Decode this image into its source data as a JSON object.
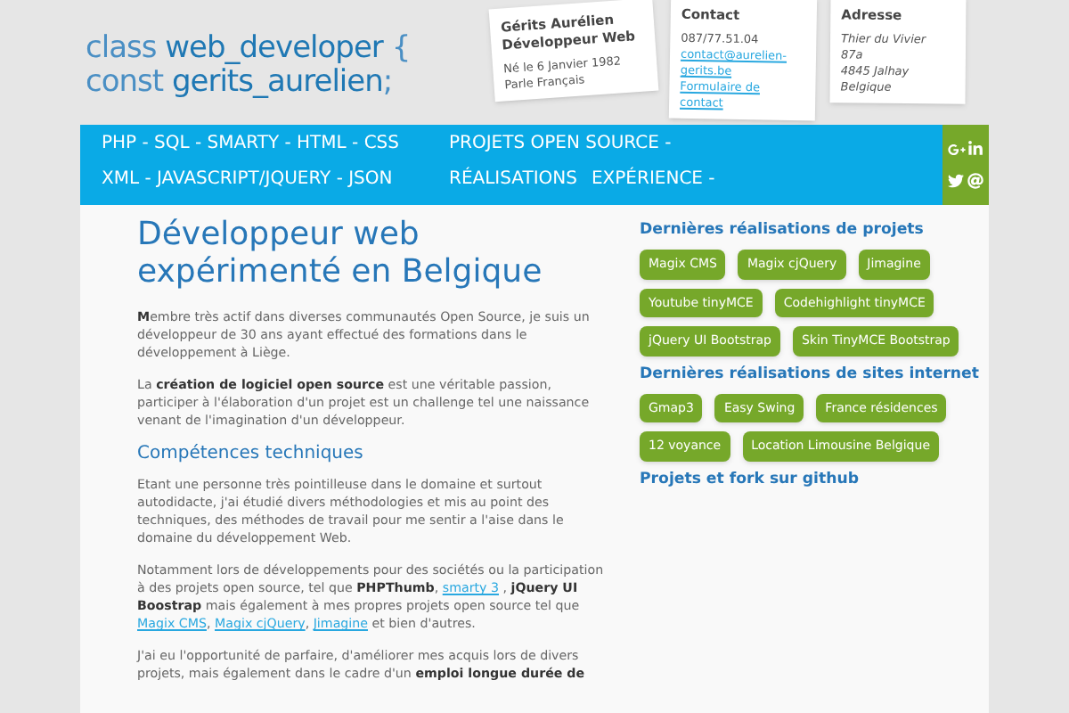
{
  "header": {
    "code_lines": [
      {
        "keyword": "class",
        "name": "web_developer",
        "suffix": "{"
      },
      {
        "keyword": "const",
        "name": "gerits_aurelien",
        "suffix": ";"
      }
    ],
    "cards": [
      {
        "title": [
          "Gérits Aurélien",
          "Développeur Web"
        ],
        "lines": [
          {
            "kind": "text",
            "text": "Né le 6 Janvier 1982"
          },
          {
            "kind": "text",
            "text": "Parle Français"
          }
        ]
      },
      {
        "title": [
          "Contact"
        ],
        "lines": [
          {
            "kind": "text",
            "text": "087/77.51.04"
          },
          {
            "kind": "link",
            "text": "contact@aurelien-gerits.be"
          },
          {
            "kind": "link",
            "text": "Formulaire de contact"
          }
        ]
      },
      {
        "title": [
          "Adresse"
        ],
        "lines": [
          {
            "kind": "italic",
            "text": "Thier du Vivier"
          },
          {
            "kind": "italic",
            "text": "87a"
          },
          {
            "kind": "italic",
            "text": "4845 Jalhay"
          },
          {
            "kind": "italic",
            "text": "Belgique"
          }
        ]
      }
    ]
  },
  "nav": {
    "skills": [
      "PHP - SQL - SMARTY - HTML - CSS",
      "XML - JAVASCRIPT/JQUERY - JSON"
    ],
    "menu": [
      [
        "PROJETS OPEN SOURCE -"
      ],
      [
        "RÉALISATIONS",
        "EXPÉRIENCE -"
      ]
    ]
  },
  "main": {
    "title": "Développeur web expérimenté en Belgique",
    "blocks": [
      {
        "kind": "paragraph",
        "segments": [
          {
            "kind": "bold",
            "text": "M"
          },
          {
            "kind": "text",
            "text": "embre très actif dans diverses communautés Open Source, je suis un développeur de 30 ans ayant effectué des formations dans le développement à Liège."
          }
        ]
      },
      {
        "kind": "paragraph",
        "segments": [
          {
            "kind": "text",
            "text": "La "
          },
          {
            "kind": "bold",
            "text": "création de logiciel open source"
          },
          {
            "kind": "text",
            "text": " est une véritable passion, participer à l'élaboration d'un projet est un challenge tel une naissance venant de l'imagination d'un développeur."
          }
        ]
      },
      {
        "kind": "heading",
        "text": "Compétences techniques"
      },
      {
        "kind": "paragraph",
        "segments": [
          {
            "kind": "text",
            "text": "Etant une personne très pointilleuse dans le domaine et surtout autodidacte, j'ai étudié divers méthodologies et mis au point des techniques, des méthodes de travail pour me sentir a l'aise dans le domaine du développement Web."
          }
        ]
      },
      {
        "kind": "paragraph",
        "segments": [
          {
            "kind": "text",
            "text": "Notamment lors de développements pour des sociétés ou la participation à des projets open source, tel que "
          },
          {
            "kind": "bold",
            "text": "PHPThumb"
          },
          {
            "kind": "text",
            "text": ", "
          },
          {
            "kind": "link",
            "text": "smarty 3"
          },
          {
            "kind": "text",
            "text": " , "
          },
          {
            "kind": "bold",
            "text": "jQuery UI Boostrap"
          },
          {
            "kind": "text",
            "text": " mais également à mes propres projets open source tel que "
          },
          {
            "kind": "link",
            "text": "Magix CMS"
          },
          {
            "kind": "text",
            "text": ", "
          },
          {
            "kind": "link",
            "text": "Magix cjQuery"
          },
          {
            "kind": "text",
            "text": ", "
          },
          {
            "kind": "link",
            "text": "Jimagine"
          },
          {
            "kind": "text",
            "text": " et bien d'autres."
          }
        ]
      },
      {
        "kind": "paragraph",
        "segments": [
          {
            "kind": "text",
            "text": "J'ai eu l'opportunité de parfaire, d'améliorer mes acquis lors de divers projets, mais également dans le cadre d'un "
          },
          {
            "kind": "bold",
            "text": "emploi longue durée de"
          }
        ]
      }
    ]
  },
  "sidebar": [
    {
      "title": "Dernières réalisations de projets",
      "tags": [
        "Magix CMS",
        "Magix cjQuery",
        "Jimagine",
        "Youtube tinyMCE",
        "Codehighlight tinyMCE",
        "jQuery UI Bootstrap",
        "Skin TinyMCE Bootstrap"
      ]
    },
    {
      "title": "Dernières réalisations de sites internet",
      "tags": [
        "Gmap3",
        "Easy Swing",
        "France résidences",
        "12 voyance",
        "Location Limousine Belgique"
      ]
    },
    {
      "title": "Projets et fork sur github"
    }
  ]
}
